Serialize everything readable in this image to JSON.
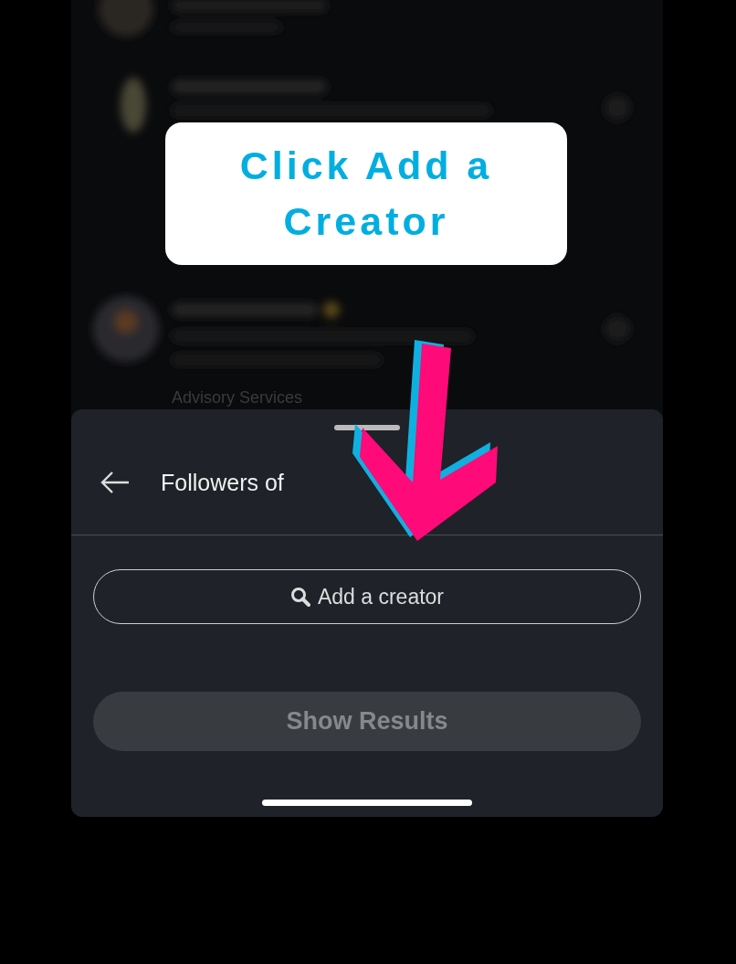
{
  "background": {
    "caption": "Advisory Services"
  },
  "callout": {
    "text": "Click Add a Creator"
  },
  "sheet": {
    "title": "Followers of",
    "add_creator": {
      "label": "Add a creator"
    },
    "show_results": {
      "label": "Show Results",
      "disabled": true
    }
  }
}
